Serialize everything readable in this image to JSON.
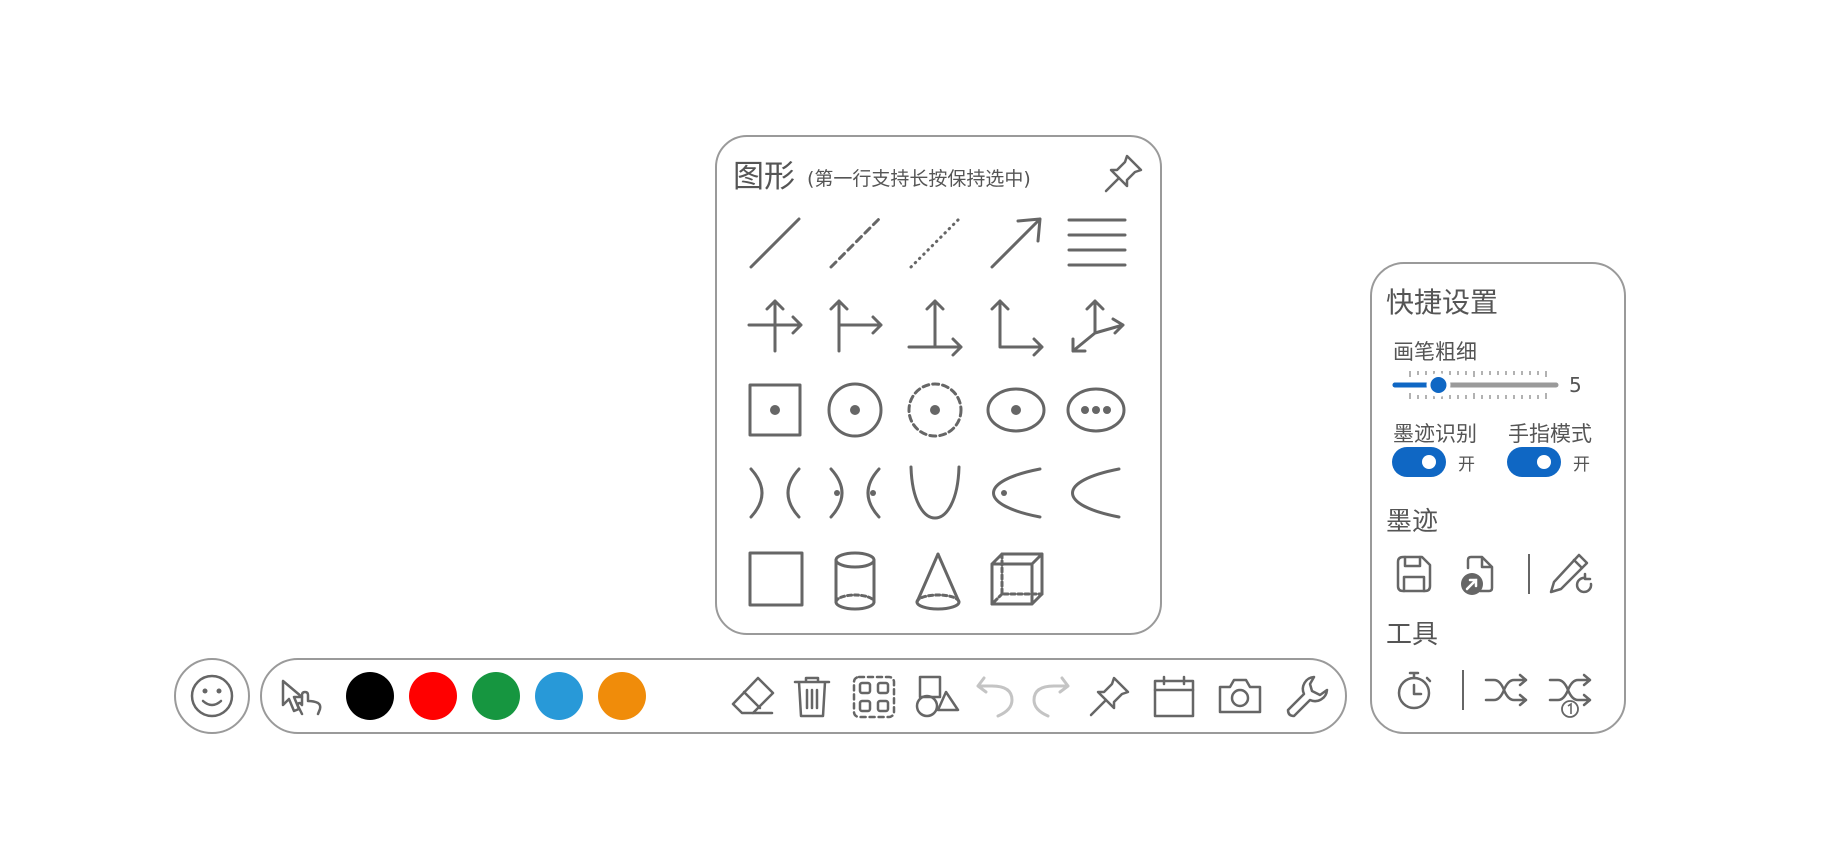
{
  "shapes_panel": {
    "title": "图形",
    "subtitle": "(第一行支持长按保持选中)",
    "pin_icon": "pin-icon",
    "rows": [
      [
        "solid-line-icon",
        "dashed-line-icon",
        "dotted-line-icon",
        "arrow-line-icon",
        "parallel-lines-icon"
      ],
      [
        "axes-cross-icon",
        "axes-t-icon",
        "axes-origin-icon",
        "axes-corner-icon",
        "axes-3d-icon"
      ],
      [
        "square-center-icon",
        "circle-center-icon",
        "dashed-circle-center-icon",
        "ellipse-center-icon",
        "ellipse-foci-icon"
      ],
      [
        "hyperbola-icon",
        "hyperbola-foci-icon",
        "parabola-icon",
        "parabola-focus-icon",
        "parabola-left-icon"
      ],
      [
        "rectangle-icon",
        "cylinder-icon",
        "cone-icon",
        "cube-icon"
      ]
    ]
  },
  "quick_settings": {
    "title": "快捷设置",
    "pen_width_label": "画笔粗细",
    "pen_width_value": "5",
    "pen_width_fraction": 0.27,
    "ink_recognition_label": "墨迹识别",
    "ink_recognition_state": "开",
    "finger_mode_label": "手指模式",
    "finger_mode_state": "开",
    "ink_section_title": "墨迹",
    "tools_section_title": "工具",
    "accent_color": "#0f67c4"
  },
  "toolbar": {
    "emoji_icon": "smiley-face-icon",
    "colors": [
      "#000000",
      "#ff0000",
      "#169640",
      "#2899d8",
      "#f08c0a"
    ],
    "tools": [
      "select-pointer-icon",
      "eraser-icon",
      "trash-icon",
      "select-area-icon",
      "shapes-icon",
      "undo-icon",
      "redo-icon",
      "pin-icon",
      "calendar-icon",
      "camera-icon",
      "wrench-icon"
    ]
  }
}
